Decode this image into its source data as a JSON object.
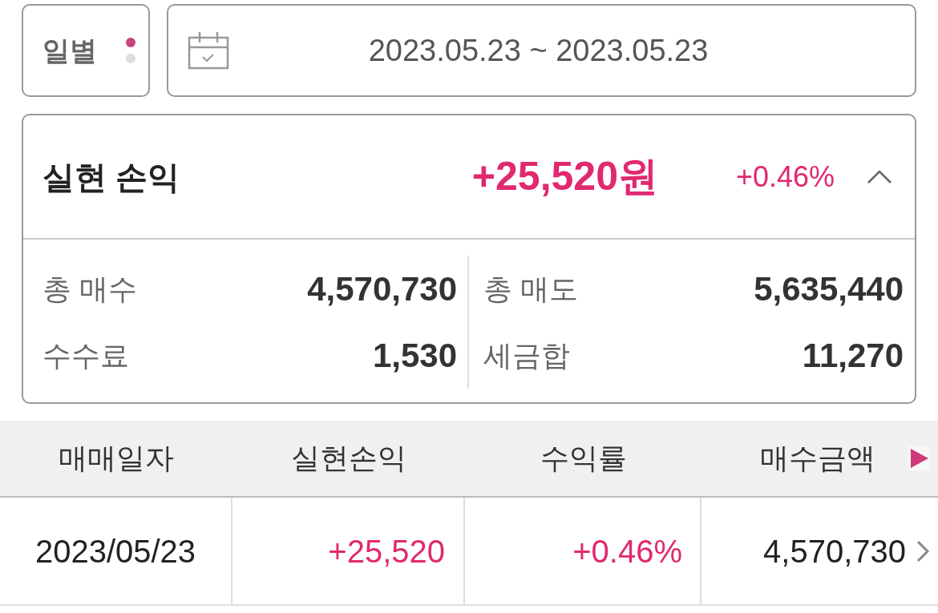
{
  "period_selector": {
    "label": "일별",
    "pages": [
      {
        "selected": true
      },
      {
        "selected": false
      }
    ]
  },
  "date_range": {
    "value": "2023.05.23 ~ 2023.05.23"
  },
  "summary": {
    "title": "실현 손익",
    "amount": "+25,520원",
    "rate": "+0.46%",
    "expanded": true,
    "items": [
      {
        "label": "총 매수",
        "value": "4,570,730"
      },
      {
        "label": "총 매도",
        "value": "5,635,440"
      },
      {
        "label": "수수료",
        "value": "1,530"
      },
      {
        "label": "세금합",
        "value": "11,270"
      }
    ]
  },
  "table": {
    "columns": [
      "매매일자",
      "실현손익",
      "수익률",
      "매수금액"
    ],
    "rows": [
      {
        "cells": [
          "2023/05/23",
          "+25,520",
          "+0.46%",
          "4,570,730"
        ]
      }
    ]
  }
}
